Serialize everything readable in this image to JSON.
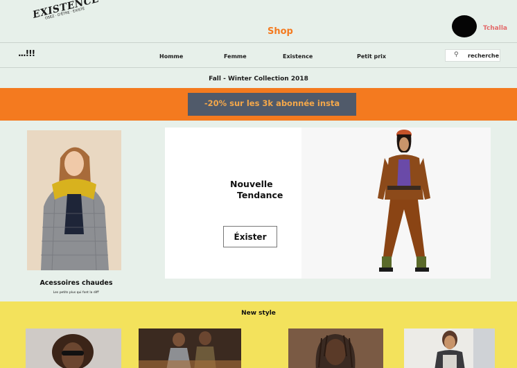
{
  "header": {
    "logo_main": "EXISTENCE",
    "logo_sub": "OSEZ · D'ÊTRE · EXISTÉ",
    "shop_title": "Shop",
    "username": "Tchalla"
  },
  "nav": {
    "menu_label": "...!!!",
    "links": [
      "Homme",
      "Femme",
      "Existence",
      "Petit prix"
    ],
    "search_placeholder": "recherche",
    "search_icon": "magnifier-icon"
  },
  "collection_title": "Fall - Winter Collection 2018",
  "promo": {
    "text": "-20% sur les 3k abonnée insta"
  },
  "left_card": {
    "caption": "Acessoires chaudes",
    "subcaption": "Les petits plus qui font la diff'"
  },
  "hero": {
    "title_line1": "Nouvelle",
    "title_line2": "Tendance",
    "button_label": "Éxister"
  },
  "new_style": {
    "title": "New style"
  },
  "colors": {
    "accent_orange": "#f47a1f",
    "background": "#e7f0ea",
    "yellow_band": "#f3e25c",
    "username": "#e36a6a"
  }
}
